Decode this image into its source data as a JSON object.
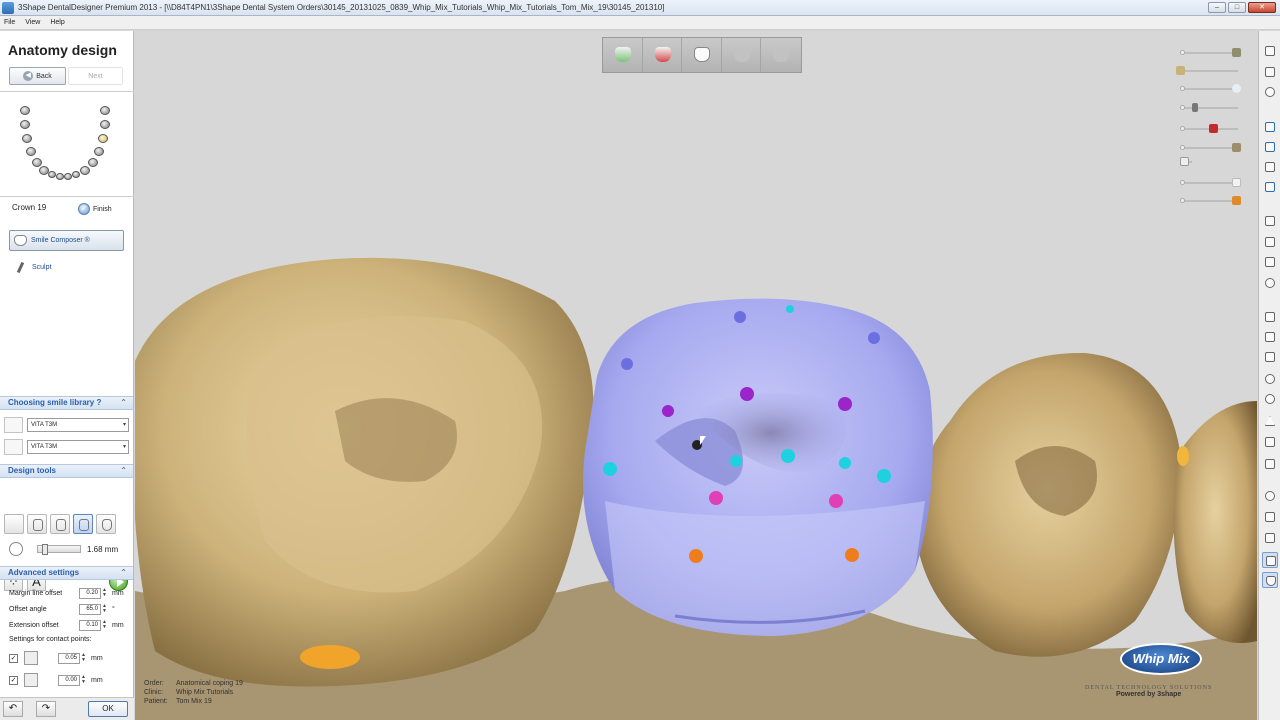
{
  "window": {
    "title": "3Shape DentalDesigner Premium 2013 - [\\\\D84T4PN1\\3Shape Dental System Orders\\30145_20131025_0839_Whip_Mix_Tutorials_Whip_Mix_Tutorials_Tom_Mix_19\\30145_201310]"
  },
  "menu": {
    "file": "File",
    "view": "View",
    "help": "Help"
  },
  "left_panel": {
    "title": "Anatomy design",
    "back_label": "Back",
    "next_label": "Next",
    "crown_label": "Crown 19",
    "finish_label": "Finish",
    "smile_composer_label": "Smile Composer ®",
    "sculpt_label": "Sculpt",
    "library_section": {
      "title": "Choosing smile library",
      "help": "?",
      "library1": "VITA T3M",
      "library2": "VITA T3M"
    },
    "design_tools": {
      "title": "Design tools",
      "value": "1.68 mm"
    },
    "advanced": {
      "title": "Advanced settings",
      "rows": [
        {
          "label": "Margin line offset",
          "value": "0.20",
          "unit": "mm"
        },
        {
          "label": "Offset angle",
          "value": "65.0",
          "unit": "°"
        },
        {
          "label": "Extension offset",
          "value": "0.10",
          "unit": "mm"
        }
      ],
      "contact_label": "Settings for contact points:",
      "contact_rows": [
        {
          "value": "0.05",
          "unit": "mm",
          "checked": "✓"
        },
        {
          "value": "0.00",
          "unit": "mm",
          "checked": "✓"
        }
      ]
    },
    "ok_label": "OK"
  },
  "viewport": {
    "info": {
      "order_key": "Order:",
      "order_val": "Anatomical coping 19",
      "clinic_key": "Clinic:",
      "clinic_val": "Whip Mix Tutorials",
      "patient_key": "Patient:",
      "patient_val": "Tom Mix 19"
    },
    "brand": {
      "logo": "Whip Mix",
      "sub": "DENTAL TECHNOLOGY SOLUTIONS",
      "powered": "Powered by 3shape"
    }
  },
  "colors": {
    "crown": "#a9acf2",
    "teeth": "#d8c08c",
    "dot_blue": "#6b6fe0",
    "dot_purple": "#9b25c9",
    "dot_cyan": "#1ed1e0",
    "dot_pink": "#e03fb5",
    "dot_orange": "#ef7d1c"
  }
}
